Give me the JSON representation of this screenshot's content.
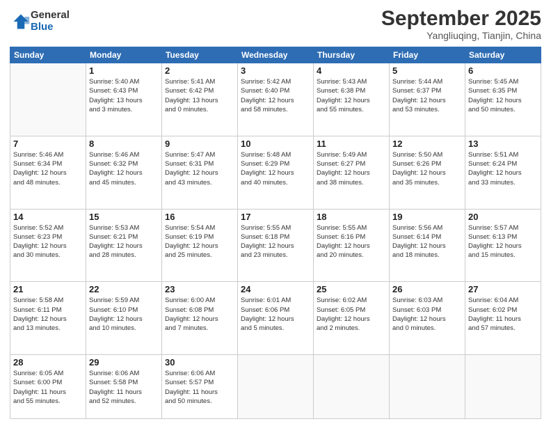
{
  "logo": {
    "general": "General",
    "blue": "Blue"
  },
  "header": {
    "month": "September 2025",
    "location": "Yangliuqing, Tianjin, China"
  },
  "days_of_week": [
    "Sunday",
    "Monday",
    "Tuesday",
    "Wednesday",
    "Thursday",
    "Friday",
    "Saturday"
  ],
  "weeks": [
    [
      {
        "day": "",
        "info": ""
      },
      {
        "day": "1",
        "info": "Sunrise: 5:40 AM\nSunset: 6:43 PM\nDaylight: 13 hours\nand 3 minutes."
      },
      {
        "day": "2",
        "info": "Sunrise: 5:41 AM\nSunset: 6:42 PM\nDaylight: 13 hours\nand 0 minutes."
      },
      {
        "day": "3",
        "info": "Sunrise: 5:42 AM\nSunset: 6:40 PM\nDaylight: 12 hours\nand 58 minutes."
      },
      {
        "day": "4",
        "info": "Sunrise: 5:43 AM\nSunset: 6:38 PM\nDaylight: 12 hours\nand 55 minutes."
      },
      {
        "day": "5",
        "info": "Sunrise: 5:44 AM\nSunset: 6:37 PM\nDaylight: 12 hours\nand 53 minutes."
      },
      {
        "day": "6",
        "info": "Sunrise: 5:45 AM\nSunset: 6:35 PM\nDaylight: 12 hours\nand 50 minutes."
      }
    ],
    [
      {
        "day": "7",
        "info": "Sunrise: 5:46 AM\nSunset: 6:34 PM\nDaylight: 12 hours\nand 48 minutes."
      },
      {
        "day": "8",
        "info": "Sunrise: 5:46 AM\nSunset: 6:32 PM\nDaylight: 12 hours\nand 45 minutes."
      },
      {
        "day": "9",
        "info": "Sunrise: 5:47 AM\nSunset: 6:31 PM\nDaylight: 12 hours\nand 43 minutes."
      },
      {
        "day": "10",
        "info": "Sunrise: 5:48 AM\nSunset: 6:29 PM\nDaylight: 12 hours\nand 40 minutes."
      },
      {
        "day": "11",
        "info": "Sunrise: 5:49 AM\nSunset: 6:27 PM\nDaylight: 12 hours\nand 38 minutes."
      },
      {
        "day": "12",
        "info": "Sunrise: 5:50 AM\nSunset: 6:26 PM\nDaylight: 12 hours\nand 35 minutes."
      },
      {
        "day": "13",
        "info": "Sunrise: 5:51 AM\nSunset: 6:24 PM\nDaylight: 12 hours\nand 33 minutes."
      }
    ],
    [
      {
        "day": "14",
        "info": "Sunrise: 5:52 AM\nSunset: 6:23 PM\nDaylight: 12 hours\nand 30 minutes."
      },
      {
        "day": "15",
        "info": "Sunrise: 5:53 AM\nSunset: 6:21 PM\nDaylight: 12 hours\nand 28 minutes."
      },
      {
        "day": "16",
        "info": "Sunrise: 5:54 AM\nSunset: 6:19 PM\nDaylight: 12 hours\nand 25 minutes."
      },
      {
        "day": "17",
        "info": "Sunrise: 5:55 AM\nSunset: 6:18 PM\nDaylight: 12 hours\nand 23 minutes."
      },
      {
        "day": "18",
        "info": "Sunrise: 5:55 AM\nSunset: 6:16 PM\nDaylight: 12 hours\nand 20 minutes."
      },
      {
        "day": "19",
        "info": "Sunrise: 5:56 AM\nSunset: 6:14 PM\nDaylight: 12 hours\nand 18 minutes."
      },
      {
        "day": "20",
        "info": "Sunrise: 5:57 AM\nSunset: 6:13 PM\nDaylight: 12 hours\nand 15 minutes."
      }
    ],
    [
      {
        "day": "21",
        "info": "Sunrise: 5:58 AM\nSunset: 6:11 PM\nDaylight: 12 hours\nand 13 minutes."
      },
      {
        "day": "22",
        "info": "Sunrise: 5:59 AM\nSunset: 6:10 PM\nDaylight: 12 hours\nand 10 minutes."
      },
      {
        "day": "23",
        "info": "Sunrise: 6:00 AM\nSunset: 6:08 PM\nDaylight: 12 hours\nand 7 minutes."
      },
      {
        "day": "24",
        "info": "Sunrise: 6:01 AM\nSunset: 6:06 PM\nDaylight: 12 hours\nand 5 minutes."
      },
      {
        "day": "25",
        "info": "Sunrise: 6:02 AM\nSunset: 6:05 PM\nDaylight: 12 hours\nand 2 minutes."
      },
      {
        "day": "26",
        "info": "Sunrise: 6:03 AM\nSunset: 6:03 PM\nDaylight: 12 hours\nand 0 minutes."
      },
      {
        "day": "27",
        "info": "Sunrise: 6:04 AM\nSunset: 6:02 PM\nDaylight: 11 hours\nand 57 minutes."
      }
    ],
    [
      {
        "day": "28",
        "info": "Sunrise: 6:05 AM\nSunset: 6:00 PM\nDaylight: 11 hours\nand 55 minutes."
      },
      {
        "day": "29",
        "info": "Sunrise: 6:06 AM\nSunset: 5:58 PM\nDaylight: 11 hours\nand 52 minutes."
      },
      {
        "day": "30",
        "info": "Sunrise: 6:06 AM\nSunset: 5:57 PM\nDaylight: 11 hours\nand 50 minutes."
      },
      {
        "day": "",
        "info": ""
      },
      {
        "day": "",
        "info": ""
      },
      {
        "day": "",
        "info": ""
      },
      {
        "day": "",
        "info": ""
      }
    ]
  ]
}
